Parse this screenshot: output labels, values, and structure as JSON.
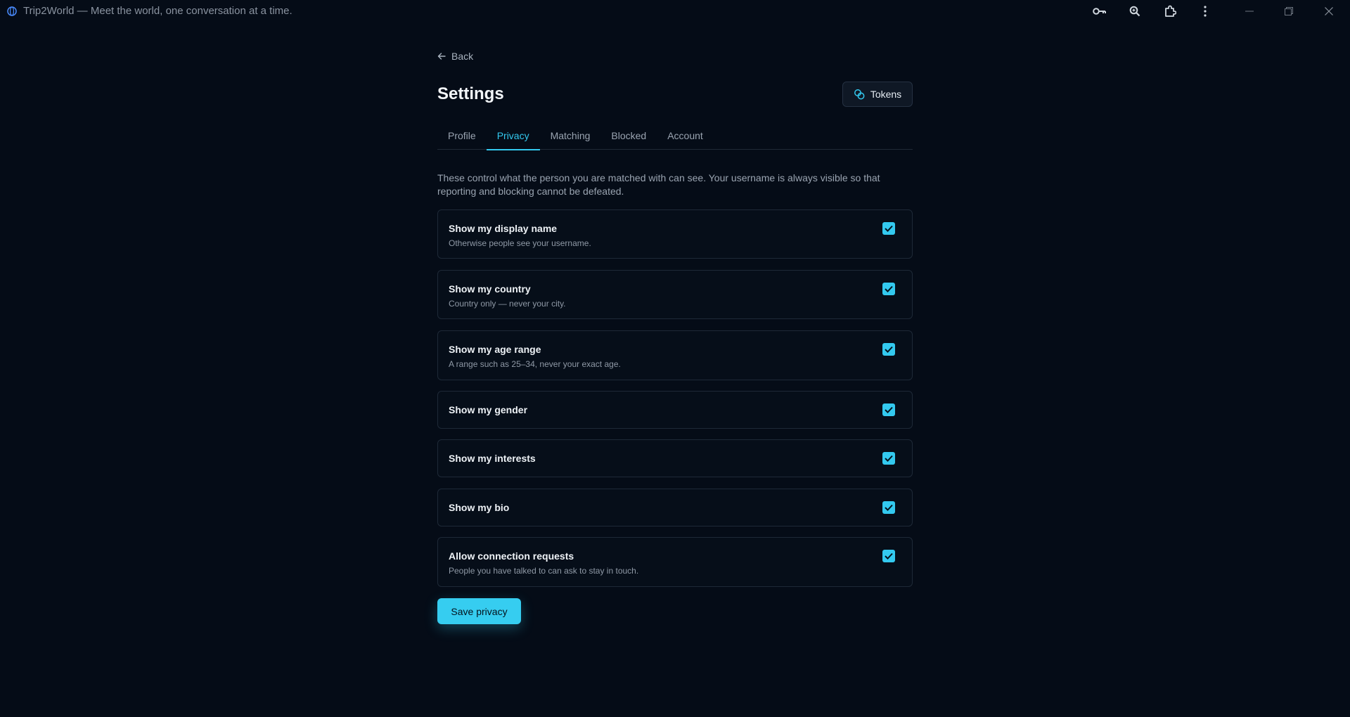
{
  "window": {
    "title": "Trip2World — Meet the world, one conversation at a time."
  },
  "toolbar_icons": [
    "key-icon",
    "zoom-icon",
    "extension-icon",
    "more-vertical-icon"
  ],
  "page": {
    "back_label": "Back",
    "title": "Settings",
    "tokens_label": "Tokens"
  },
  "tabs": [
    {
      "label": "Profile",
      "active": false
    },
    {
      "label": "Privacy",
      "active": true
    },
    {
      "label": "Matching",
      "active": false
    },
    {
      "label": "Blocked",
      "active": false
    },
    {
      "label": "Account",
      "active": false
    }
  ],
  "privacy": {
    "description": "These control what the person you are matched with can see. Your username is always visible so that reporting and blocking cannot be defeated.",
    "options": [
      {
        "title": "Show my display name",
        "subtitle": "Otherwise people see your username.",
        "checked": true
      },
      {
        "title": "Show my country",
        "subtitle": "Country only — never your city.",
        "checked": true
      },
      {
        "title": "Show my age range",
        "subtitle": "A range such as 25–34, never your exact age.",
        "checked": true
      },
      {
        "title": "Show my gender",
        "subtitle": "",
        "checked": true
      },
      {
        "title": "Show my interests",
        "subtitle": "",
        "checked": true
      },
      {
        "title": "Show my bio",
        "subtitle": "",
        "checked": true
      },
      {
        "title": "Allow connection requests",
        "subtitle": "People you have talked to can ask to stay in touch.",
        "checked": true
      }
    ],
    "save_label": "Save privacy"
  },
  "colors": {
    "background": "#050c17",
    "accent": "#33c9ef"
  }
}
